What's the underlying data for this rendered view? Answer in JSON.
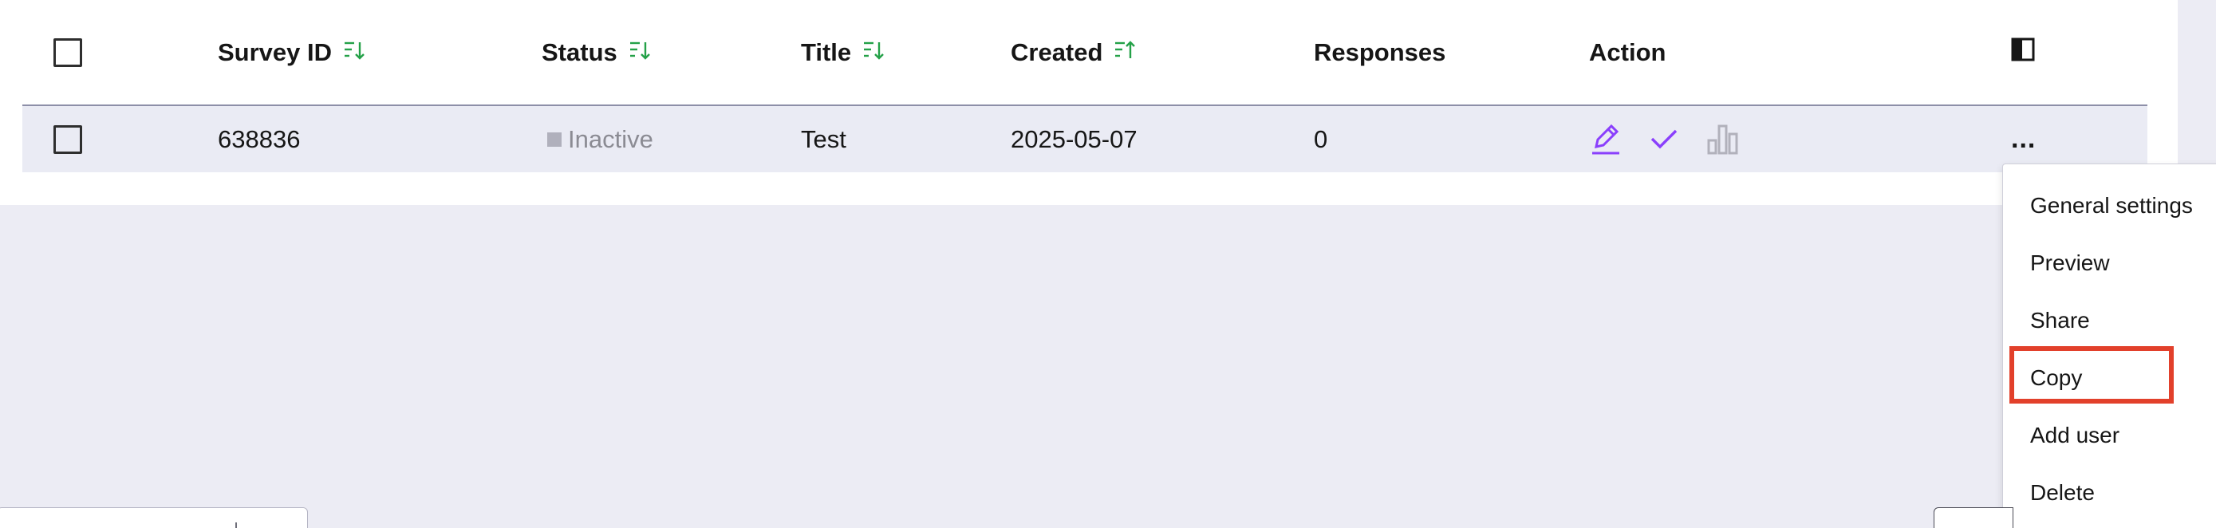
{
  "table": {
    "headers": {
      "survey_id": "Survey ID",
      "status": "Status",
      "title": "Title",
      "created": "Created",
      "responses": "Responses",
      "action": "Action"
    },
    "rows": [
      {
        "survey_id": "638836",
        "status": "Inactive",
        "title": "Test",
        "created": "2025-05-07",
        "responses": "0"
      }
    ]
  },
  "overflow_menu": {
    "trigger": "...",
    "items": [
      "General settings",
      "Preview",
      "Share",
      "Copy",
      "Add user",
      "Delete"
    ],
    "highlighted": "Copy"
  },
  "colors": {
    "sort_icon": "#24a148",
    "action_icon": "#8a3ffc",
    "highlight": "#e2402b",
    "row_background": "#eaebf4"
  }
}
